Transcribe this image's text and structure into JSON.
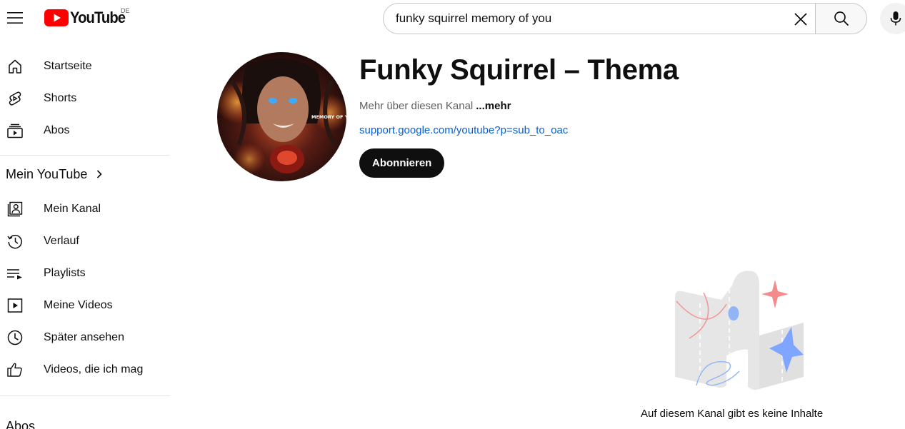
{
  "header": {
    "logo_text": "YouTube",
    "region_code": "DE",
    "search_value": "funky squirrel memory of you"
  },
  "sidebar": {
    "main_items": [
      {
        "label": "Startseite",
        "icon": "home-icon"
      },
      {
        "label": "Shorts",
        "icon": "shorts-icon"
      },
      {
        "label": "Abos",
        "icon": "subscriptions-icon"
      }
    ],
    "you_section": {
      "title": "Mein YouTube",
      "items": [
        {
          "label": "Mein Kanal",
          "icon": "your-channel-icon"
        },
        {
          "label": "Verlauf",
          "icon": "history-icon"
        },
        {
          "label": "Playlists",
          "icon": "playlists-icon"
        },
        {
          "label": "Meine Videos",
          "icon": "your-videos-icon"
        },
        {
          "label": "Später ansehen",
          "icon": "watch-later-icon"
        },
        {
          "label": "Videos, die ich mag",
          "icon": "like-icon"
        }
      ]
    },
    "subscriptions_title": "Abos"
  },
  "channel": {
    "title": "Funky Squirrel – Thema",
    "about_text": "Mehr über diesen Kanal",
    "more_label": "...mehr",
    "link_text": "support.google.com/youtube?p=sub_to_oac",
    "subscribe_label": "Abonnieren",
    "avatar_overlay_text": "MEMORY OF YOU"
  },
  "empty_state": {
    "message": "Auf diesem Kanal gibt es keine Inhalte"
  },
  "colors": {
    "brand_red": "#ff0000",
    "link_blue": "#065fd4",
    "text_primary": "#0f0f0f",
    "text_secondary": "#606060",
    "subscribe_bg": "#0f0f0f"
  }
}
